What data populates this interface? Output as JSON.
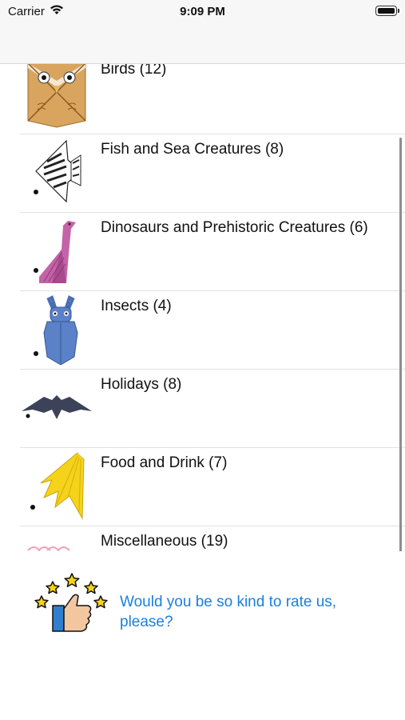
{
  "status_bar": {
    "carrier": "Carrier",
    "time": "9:09 PM"
  },
  "categories": [
    {
      "label": "Birds (12)",
      "icon": "origami-owl-icon"
    },
    {
      "label": "Fish and Sea Creatures (8)",
      "icon": "origami-angelfish-icon"
    },
    {
      "label": "Dinosaurs and Prehistoric Creatures (6)",
      "icon": "origami-dinosaur-icon"
    },
    {
      "label": "Insects (4)",
      "icon": "origami-beetle-icon"
    },
    {
      "label": "Holidays (8)",
      "icon": "origami-bat-icon"
    },
    {
      "label": "Food and Drink (7)",
      "icon": "origami-banana-icon"
    },
    {
      "label": "Miscellaneous (19)",
      "icon": "origami-misc-icon"
    }
  ],
  "rate": {
    "text": "Would you be so kind to rate us, please?",
    "icon": "thumbs-up-stars-icon"
  },
  "colors": {
    "link": "#1a7fde",
    "separator": "#e2e2e2",
    "nav_background": "#f7f7f7"
  }
}
